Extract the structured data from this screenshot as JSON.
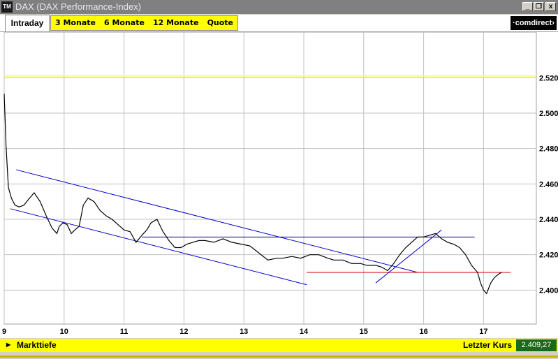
{
  "window": {
    "title": "DAX (DAX Performance-Index)",
    "icon": "TM"
  },
  "window_controls": {
    "minimize": "_",
    "restore": "❐",
    "close": "x"
  },
  "tabs": {
    "active": "Intraday",
    "items": [
      "3 Monate",
      "6 Monate",
      "12 Monate",
      "Quote"
    ]
  },
  "brand": {
    "logo": "·comdirect›"
  },
  "status": {
    "markttiefe": "Markttiefe",
    "last_label": "Letzter Kurs",
    "last_value": "2.409,27"
  },
  "colors": {
    "price": "#000000",
    "channel": "#0000cc",
    "support": "#cc0000",
    "reference": "#ffff66",
    "grid": "#c0c0c0"
  },
  "chart_data": {
    "type": "line",
    "xlim": [
      9,
      18.0
    ],
    "ylim": [
      2380,
      2545
    ],
    "x_ticks": [
      9,
      10,
      11,
      12,
      13,
      14,
      15,
      16,
      17
    ],
    "y_ticks": [
      2400,
      2420,
      2440,
      2460,
      2480,
      2500,
      2520
    ],
    "y_tick_labels": [
      "2.400",
      "2.420",
      "2.440",
      "2.460",
      "2.480",
      "2.500",
      "2.520"
    ],
    "reference_level": 2521,
    "series": [
      {
        "x": [
          9.0,
          9.03,
          9.07,
          9.12,
          9.18,
          9.25,
          9.33,
          9.4,
          9.5,
          9.6,
          9.7,
          9.8,
          9.88,
          9.92,
          9.98,
          10.05,
          10.12,
          10.18,
          10.25,
          10.32,
          10.4,
          10.5,
          10.6,
          10.7,
          10.8,
          10.9,
          11.0,
          11.1,
          11.2,
          11.3,
          11.38,
          11.45,
          11.55,
          11.65,
          11.75,
          11.85,
          11.95,
          12.05,
          12.15,
          12.25,
          12.35,
          12.5,
          12.65,
          12.8,
          12.95,
          13.1,
          13.25,
          13.4,
          13.55,
          13.65,
          13.8,
          13.95,
          14.1,
          14.25,
          14.4,
          14.5,
          14.65,
          14.8,
          14.95,
          15.05,
          15.2,
          15.3,
          15.4,
          15.5,
          15.6,
          15.7,
          15.8,
          15.9,
          16.0,
          16.1,
          16.2,
          16.3,
          16.4,
          16.5,
          16.6,
          16.7,
          16.8,
          16.9,
          16.95,
          17.0,
          17.05,
          17.12,
          17.18,
          17.25,
          17.3
        ],
        "y": [
          2511,
          2482,
          2458,
          2452,
          2448,
          2447,
          2448,
          2451,
          2455,
          2450,
          2442,
          2435,
          2432,
          2436,
          2438,
          2437,
          2432,
          2434,
          2436,
          2448,
          2452,
          2450,
          2445,
          2442,
          2440,
          2437,
          2434,
          2433,
          2427,
          2431,
          2434,
          2438,
          2440,
          2433,
          2428,
          2424,
          2424,
          2426,
          2427,
          2428,
          2428,
          2427,
          2429,
          2427,
          2426,
          2425,
          2421,
          2417,
          2418,
          2418,
          2419,
          2418,
          2420,
          2420,
          2418,
          2417,
          2417,
          2415,
          2415,
          2414,
          2414,
          2413,
          2411,
          2415,
          2420,
          2424,
          2427,
          2430,
          2430,
          2431,
          2432,
          2429,
          2427,
          2426,
          2424,
          2420,
          2414,
          2410,
          2404,
          2400,
          2398,
          2404,
          2407,
          2409,
          2410
        ]
      }
    ],
    "lines": [
      {
        "name": "channel-upper",
        "x": [
          9.2,
          15.9
        ],
        "y": [
          2468,
          2410
        ]
      },
      {
        "name": "channel-lower",
        "x": [
          9.1,
          14.05
        ],
        "y": [
          2446,
          2403
        ]
      },
      {
        "name": "resistance",
        "x": [
          11.3,
          16.85
        ],
        "y": [
          2430,
          2430
        ]
      },
      {
        "name": "support",
        "x": [
          14.05,
          17.45
        ],
        "y": [
          2410,
          2410
        ]
      },
      {
        "name": "uptrend",
        "x": [
          15.2,
          16.3
        ],
        "y": [
          2404,
          2434
        ]
      }
    ]
  }
}
